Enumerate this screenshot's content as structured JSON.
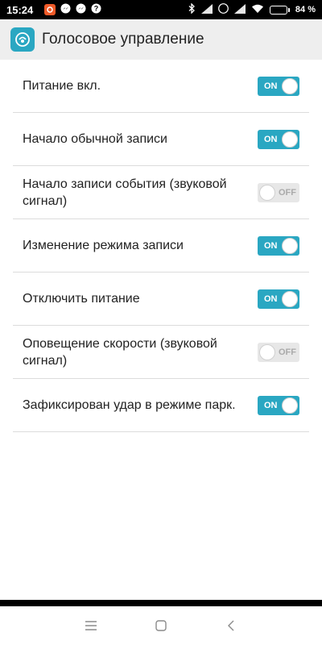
{
  "status": {
    "time": "15:24",
    "battery_text": "84 %",
    "battery_level": 0.84,
    "notification_icons": [
      "app-icon",
      "messenger-icon",
      "messenger-icon",
      "unknown-icon"
    ],
    "system_icons": [
      "bluetooth-icon",
      "signal-icon",
      "signal-icon",
      "r-badge-icon",
      "signal-icon",
      "wifi-icon"
    ],
    "r_badge": "R"
  },
  "appbar": {
    "title": "Голосовое управление",
    "icon": "voice-control-icon"
  },
  "settings": [
    {
      "label": "Питание вкл.",
      "state": "ON",
      "on": true
    },
    {
      "label": "Начало обычной записи",
      "state": "ON",
      "on": true
    },
    {
      "label": "Начало записи события (звуковой сигнал)",
      "state": "OFF",
      "on": false
    },
    {
      "label": "Изменение режима записи",
      "state": "ON",
      "on": true
    },
    {
      "label": "Отключить питание",
      "state": "ON",
      "on": true
    },
    {
      "label": "Оповещение скорости (звуковой сигнал)",
      "state": "OFF",
      "on": false
    },
    {
      "label": "Зафиксирован удар в режиме парк.",
      "state": "ON",
      "on": true
    }
  ],
  "navbar": {
    "items": [
      "menu-icon",
      "home-icon",
      "back-icon"
    ]
  },
  "colors": {
    "accent": "#2aa7c2",
    "appbar_bg": "#eeeeee",
    "toggle_off_bg": "#e7e7e7"
  }
}
